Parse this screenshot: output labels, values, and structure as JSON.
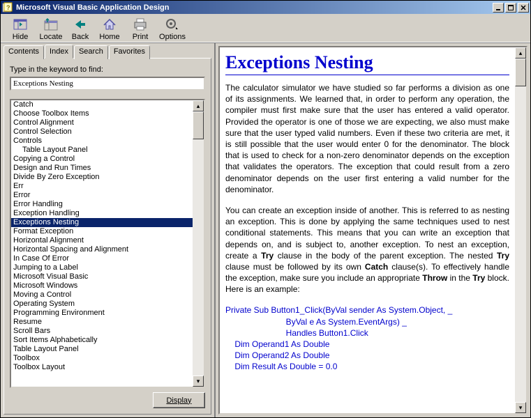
{
  "window": {
    "title": "Microsoft Visual Basic Application Design"
  },
  "toolbar": {
    "hide": "Hide",
    "locate": "Locate",
    "back": "Back",
    "home": "Home",
    "print": "Print",
    "options": "Options"
  },
  "tabs": {
    "contents": "Contents",
    "index": "Index",
    "search": "Search",
    "favorites": "Favorites"
  },
  "index": {
    "label": "Type in the keyword to find:",
    "value": "Exceptions Nesting",
    "display_btn": "Display",
    "items": [
      {
        "t": "Catch",
        "i": 0,
        "sel": false
      },
      {
        "t": "Choose Toolbox Items",
        "i": 0,
        "sel": false
      },
      {
        "t": "Control Alignment",
        "i": 0,
        "sel": false
      },
      {
        "t": "Control Selection",
        "i": 0,
        "sel": false
      },
      {
        "t": "Controls",
        "i": 0,
        "sel": false
      },
      {
        "t": "Table Layout Panel",
        "i": 1,
        "sel": false
      },
      {
        "t": "Copying a Control",
        "i": 0,
        "sel": false
      },
      {
        "t": "Design and Run Times",
        "i": 0,
        "sel": false
      },
      {
        "t": "Divide By Zero Exception",
        "i": 0,
        "sel": false
      },
      {
        "t": "Err",
        "i": 0,
        "sel": false
      },
      {
        "t": "Error",
        "i": 0,
        "sel": false
      },
      {
        "t": "Error Handling",
        "i": 0,
        "sel": false
      },
      {
        "t": "Exception Handling",
        "i": 0,
        "sel": false
      },
      {
        "t": "Exceptions Nesting",
        "i": 0,
        "sel": true
      },
      {
        "t": "Format Exception",
        "i": 0,
        "sel": false
      },
      {
        "t": "Horizontal Alignment",
        "i": 0,
        "sel": false
      },
      {
        "t": "Horizontal Spacing and Alignment",
        "i": 0,
        "sel": false
      },
      {
        "t": "In Case Of Error",
        "i": 0,
        "sel": false
      },
      {
        "t": "Jumping to a Label",
        "i": 0,
        "sel": false
      },
      {
        "t": "Microsoft Visual Basic",
        "i": 0,
        "sel": false
      },
      {
        "t": "Microsoft Windows",
        "i": 0,
        "sel": false
      },
      {
        "t": "Moving a Control",
        "i": 0,
        "sel": false
      },
      {
        "t": "Operating System",
        "i": 0,
        "sel": false
      },
      {
        "t": "Programming Environment",
        "i": 0,
        "sel": false
      },
      {
        "t": "Resume",
        "i": 0,
        "sel": false
      },
      {
        "t": "Scroll Bars",
        "i": 0,
        "sel": false
      },
      {
        "t": "Sort Items Alphabetically",
        "i": 0,
        "sel": false
      },
      {
        "t": "Table Layout Panel",
        "i": 0,
        "sel": false
      },
      {
        "t": "Toolbox",
        "i": 0,
        "sel": false
      },
      {
        "t": "Toolbox Layout",
        "i": 0,
        "sel": false
      }
    ]
  },
  "doc": {
    "title": "Exceptions Nesting",
    "p1_a": "The calculator simulator we have studied so far performs a division as one of its assignments. We learned that, in order to perform any operation, the compiler must first make sure that the user has entered a valid operator. Provided the operator is one of those we are expecting, we also must make sure that the user typed valid numbers. Even if these two criteria are met, it is still possible that the user would enter 0 for the denominator. The block that is used to check for a non-zero denominator depends on the exception that validates the operators. The exception that could result from a zero denominator depends on the user first entering a valid number for the denominator.",
    "p2_a": "You can create an exception inside of another. This is referred to as nesting an exception. This is done by applying the same techniques used to nest conditional statements. This means that you can write an exception that depends on, and is subject to, another exception. To nest an exception, create a ",
    "p2_b": "Try",
    "p2_c": " clause in the body of the parent exception. The nested ",
    "p2_d": "Try",
    "p2_e": " clause must be followed by its own ",
    "p2_f": "Catch",
    "p2_g": " clause(s). To effectively handle the exception, make sure you include an appropriate ",
    "p2_h": "Throw",
    "p2_i": " in the ",
    "p2_j": "Try",
    "p2_k": " block. Here is an example:",
    "code": "Private Sub Button1_Click(ByVal sender As System.Object, _\n                          ByVal e As System.EventArgs) _\n                          Handles Button1.Click\n    Dim Operand1 As Double\n    Dim Operand2 As Double\n    Dim Result As Double = 0.0"
  }
}
